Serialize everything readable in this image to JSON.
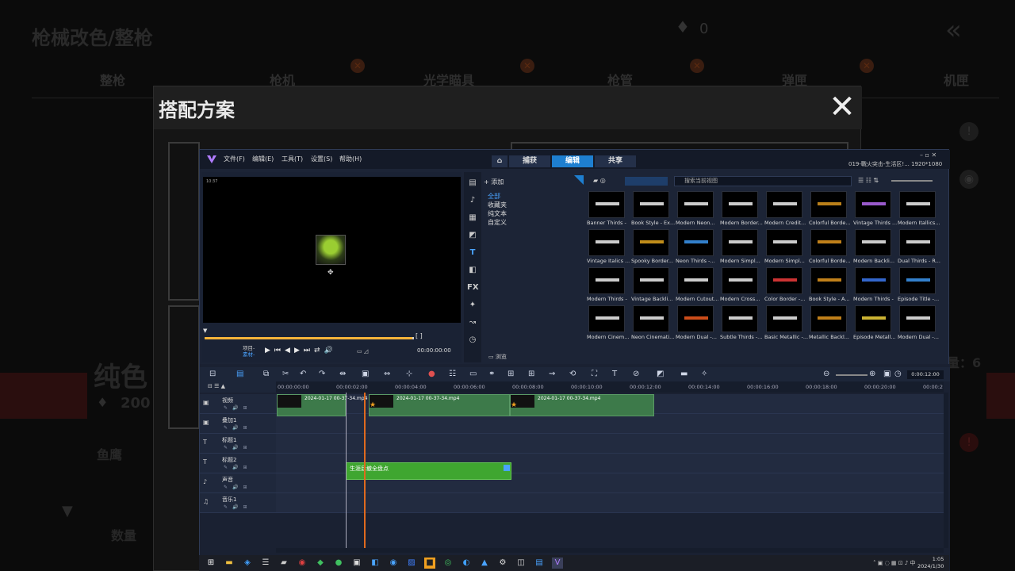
{
  "background": {
    "title": "枪械改色/整枪",
    "gem_count": "0",
    "tabs": [
      "整枪",
      "枪机",
      "光学瞄具",
      "枪管",
      "弹匣",
      "机匣"
    ],
    "side_heading": "纯色",
    "side_price": "200",
    "side_label": "鱼鹰",
    "side_bottom": "数量",
    "right_count": "量：6"
  },
  "dialog": {
    "title": "搭配方案",
    "close_symbol": "✕"
  },
  "editor": {
    "menu": [
      "文件(F)",
      "编辑(E)",
      "工具(T)",
      "设置(S)",
      "帮助(H)"
    ],
    "modes": [
      "捕获",
      "编辑",
      "共享"
    ],
    "active_mode": "编辑",
    "project_title": "019-戰火突击-生活区!...  1920*1080",
    "preview_time": "10:37",
    "controls": {
      "project_label": "项目-",
      "clip_label": "素材-",
      "timecode": "00:00:00:00"
    },
    "library": {
      "add_label": "添加",
      "categories": [
        "全部",
        "收藏夹",
        "纯文本",
        "自定义"
      ],
      "selected_category": "全部",
      "search_placeholder": "搜索当前视图",
      "browse_label": "浏览",
      "tiles": [
        "Banner Thirds -",
        "Book Style - Ex...",
        "Modern Neon...",
        "Modern Border...",
        "Modern Credit...",
        "Colorful Borde...",
        "Vintage Thirds ...",
        "Modern Itallics...",
        "Vintage Italics ...",
        "Spooky Border...",
        "Neon Thirds -...",
        "Modern Simpl...",
        "Modern Simpl...",
        "Colorful Borde...",
        "Modern Backli...",
        "Dual Thirds - R...",
        "Modern Thirds -",
        "Vintage Backli...",
        "Modern Cutout...",
        "Modern Cross...",
        "Color Border -...",
        "Book Style - A...",
        "Modern Thirds -",
        "Episode Title -...",
        "Modern Cinem...",
        "Neon Cinemati...",
        "Modern Dual -...",
        "Subtle Thirds -...",
        "Basic Metallic -...",
        "Metallic Backl...",
        "Episode Metall...",
        "Modern Dual -..."
      ],
      "tile_colors": [
        "#ffffff",
        "#ffffff",
        "#ffffff",
        "#ffffff",
        "#ffffff",
        "#e8a020",
        "#c070ff",
        "#ffffff",
        "#ffffff",
        "#f0b020",
        "#40a0ff",
        "#ffffff",
        "#ffffff",
        "#f0a020",
        "#ffffff",
        "#ffffff",
        "#ffffff",
        "#ffffff",
        "#ffffff",
        "#ffffff",
        "#ff4040",
        "#f0a020",
        "#4080ff",
        "#40a0ff",
        "#ffffff",
        "#ffffff",
        "#ff6020",
        "#ffffff",
        "#ffffff",
        "#f0a020",
        "#ffe040",
        "#ffffff"
      ]
    },
    "timeline": {
      "timecode": "0:00:12:00",
      "ruler": [
        "00:00:00:00",
        "00:00:02:00",
        "00:00:04:00",
        "00:00:06:00",
        "00:00:08:00",
        "00:00:10:00",
        "00:00:12:00",
        "00:00:14:00",
        "00:00:16:00",
        "00:00:18:00",
        "00:00:20:00",
        "00:00:2"
      ],
      "tracks": [
        "视频",
        "叠加1",
        "标题1",
        "标题2",
        "声音",
        "音乐1"
      ],
      "clips": [
        "2024-01-17 00-37-34.mp4",
        "2024-01-17 00-37-34.mp4",
        "2024-01-17 00-37-34.mp4"
      ],
      "title_clip": "生涯后撤全盘点"
    },
    "taskbar": {
      "time": "1:05",
      "date": "2024/1/30"
    }
  }
}
